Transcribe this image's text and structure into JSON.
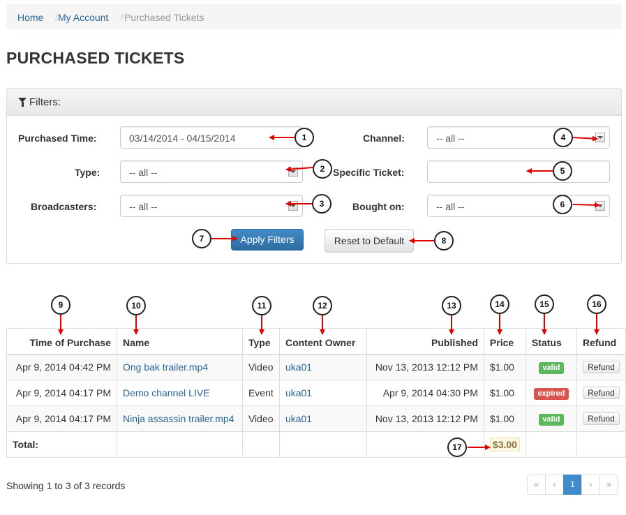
{
  "breadcrumb": {
    "home": "Home",
    "account": "My Account",
    "current": "Purchased Tickets",
    "separator": "/"
  },
  "page_title": "PURCHASED TICKETS",
  "filters": {
    "heading": "Filters:",
    "purchased_time": {
      "label": "Purchased Time:",
      "value": "03/14/2014 - 04/15/2014"
    },
    "type": {
      "label": "Type:",
      "value": "-- all --"
    },
    "broadcasters": {
      "label": "Broadcasters:",
      "value": "-- all --"
    },
    "channel": {
      "label": "Channel:",
      "value": "-- all --"
    },
    "specific_ticket": {
      "label": "Specific Ticket:",
      "value": ""
    },
    "bought_on": {
      "label": "Bought on:",
      "value": "-- all --"
    },
    "apply_label": "Apply Filters",
    "reset_label": "Reset to Default"
  },
  "callouts": [
    "1",
    "2",
    "3",
    "4",
    "5",
    "6",
    "7",
    "8",
    "9",
    "10",
    "11",
    "12",
    "13",
    "14",
    "15",
    "16",
    "17"
  ],
  "table": {
    "headers": [
      "Time of Purchase",
      "Name",
      "Type",
      "Content Owner",
      "Published",
      "Price",
      "Status",
      "Refund"
    ],
    "rows": [
      {
        "time": "Apr 9, 2014 04:42 PM",
        "name": "Ong bak trailer.mp4",
        "type": "Video",
        "owner": "uka01",
        "published": "Nov 13, 2013 12:12 PM",
        "price": "$1.00",
        "status": "valid",
        "refund": "Refund"
      },
      {
        "time": "Apr 9, 2014 04:17 PM",
        "name": "Demo channel LIVE",
        "type": "Event",
        "owner": "uka01",
        "published": "Apr 9, 2014 04:30 PM",
        "price": "$1.00",
        "status": "expired",
        "refund": "Refund"
      },
      {
        "time": "Apr 9, 2014 04:17 PM",
        "name": "Ninja assassin trailer.mp4",
        "type": "Video",
        "owner": "uka01",
        "published": "Nov 13, 2013 12:12 PM",
        "price": "$1.00",
        "status": "valid",
        "refund": "Refund"
      }
    ],
    "total_label": "Total:",
    "total_value": "$3.00"
  },
  "footer": {
    "showing": "Showing 1 to 3 of 3 records",
    "pager": {
      "first": "«",
      "prev": "‹",
      "page": "1",
      "next": "›",
      "last": "»"
    }
  },
  "colors": {
    "link": "#2a6496",
    "primary": "#428bca",
    "valid": "#5cb85c",
    "expired": "#d9534f",
    "arrow": "#e00000"
  }
}
